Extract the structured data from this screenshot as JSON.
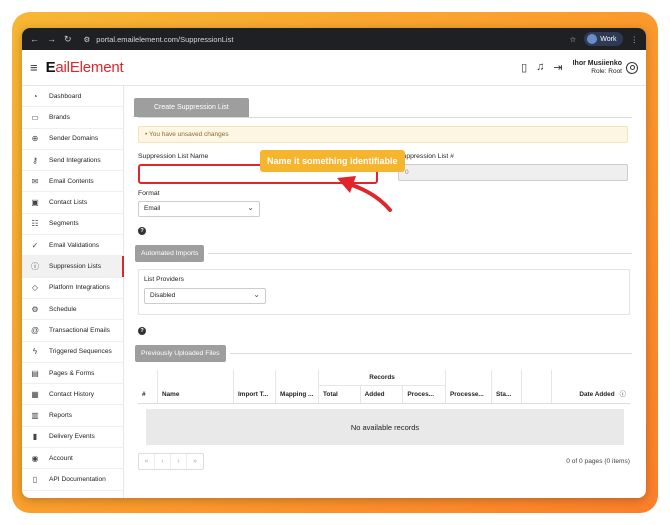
{
  "browser": {
    "url": "portal.emailelement.com/SuppressionList",
    "profile": "Work"
  },
  "header": {
    "logo_e": "E",
    "logo_rest": "ailElement",
    "user_name": "Ihor Musiienko",
    "user_role": "Role: Root"
  },
  "sidebar": {
    "items": [
      {
        "label": "Dashboard",
        "icon": "dashboard-icon"
      },
      {
        "label": "Brands",
        "icon": "brands-icon"
      },
      {
        "label": "Sender Domains",
        "icon": "globe-icon"
      },
      {
        "label": "Send Integrations",
        "icon": "key-icon"
      },
      {
        "label": "Email Contents",
        "icon": "envelope-icon"
      },
      {
        "label": "Contact Lists",
        "icon": "contacts-icon"
      },
      {
        "label": "Segments",
        "icon": "segments-icon"
      },
      {
        "label": "Email Validations",
        "icon": "check-circle-icon"
      },
      {
        "label": "Suppression Lists",
        "icon": "alert-icon"
      },
      {
        "label": "Platform Integrations",
        "icon": "tag-icon"
      },
      {
        "label": "Schedule",
        "icon": "gear-icon"
      },
      {
        "label": "Transactional Emails",
        "icon": "at-icon"
      },
      {
        "label": "Triggered Sequences",
        "icon": "bolt-icon"
      },
      {
        "label": "Pages & Forms",
        "icon": "pages-icon"
      },
      {
        "label": "Contact History",
        "icon": "history-icon"
      },
      {
        "label": "Reports",
        "icon": "reports-icon"
      },
      {
        "label": "Delivery Events",
        "icon": "chart-icon"
      },
      {
        "label": "Account",
        "icon": "account-icon"
      },
      {
        "label": "API Documentation",
        "icon": "book-icon"
      }
    ]
  },
  "main": {
    "tab_label": "Create Suppression List",
    "warning": "You have unsaved changes",
    "name_label": "Suppression List Name",
    "name_value": "",
    "number_label": "Suppression List #",
    "number_value": "0",
    "format_label": "Format",
    "format_value": "Email",
    "automated_imports": "Automated Imports",
    "list_providers_label": "List Providers",
    "list_providers_value": "Disabled",
    "previous_files": "Previously Uploaded Files",
    "table": {
      "records_group": "Records",
      "columns": [
        "#",
        "Name",
        "Import T...",
        "Mapping ...",
        "Total",
        "Added",
        "Proces...",
        "Processe...",
        "Sta...",
        "",
        "Date Added"
      ],
      "empty": "No available records",
      "pager_buttons": [
        "«",
        "‹",
        "›",
        "»"
      ],
      "pager_info": "0 of 0 pages (0 items)"
    },
    "callout": "Name it something identifiable"
  },
  "colors": {
    "accent": "#e0262b",
    "callout": "#f5b52d",
    "background_gradient": "#fb9a2c"
  }
}
